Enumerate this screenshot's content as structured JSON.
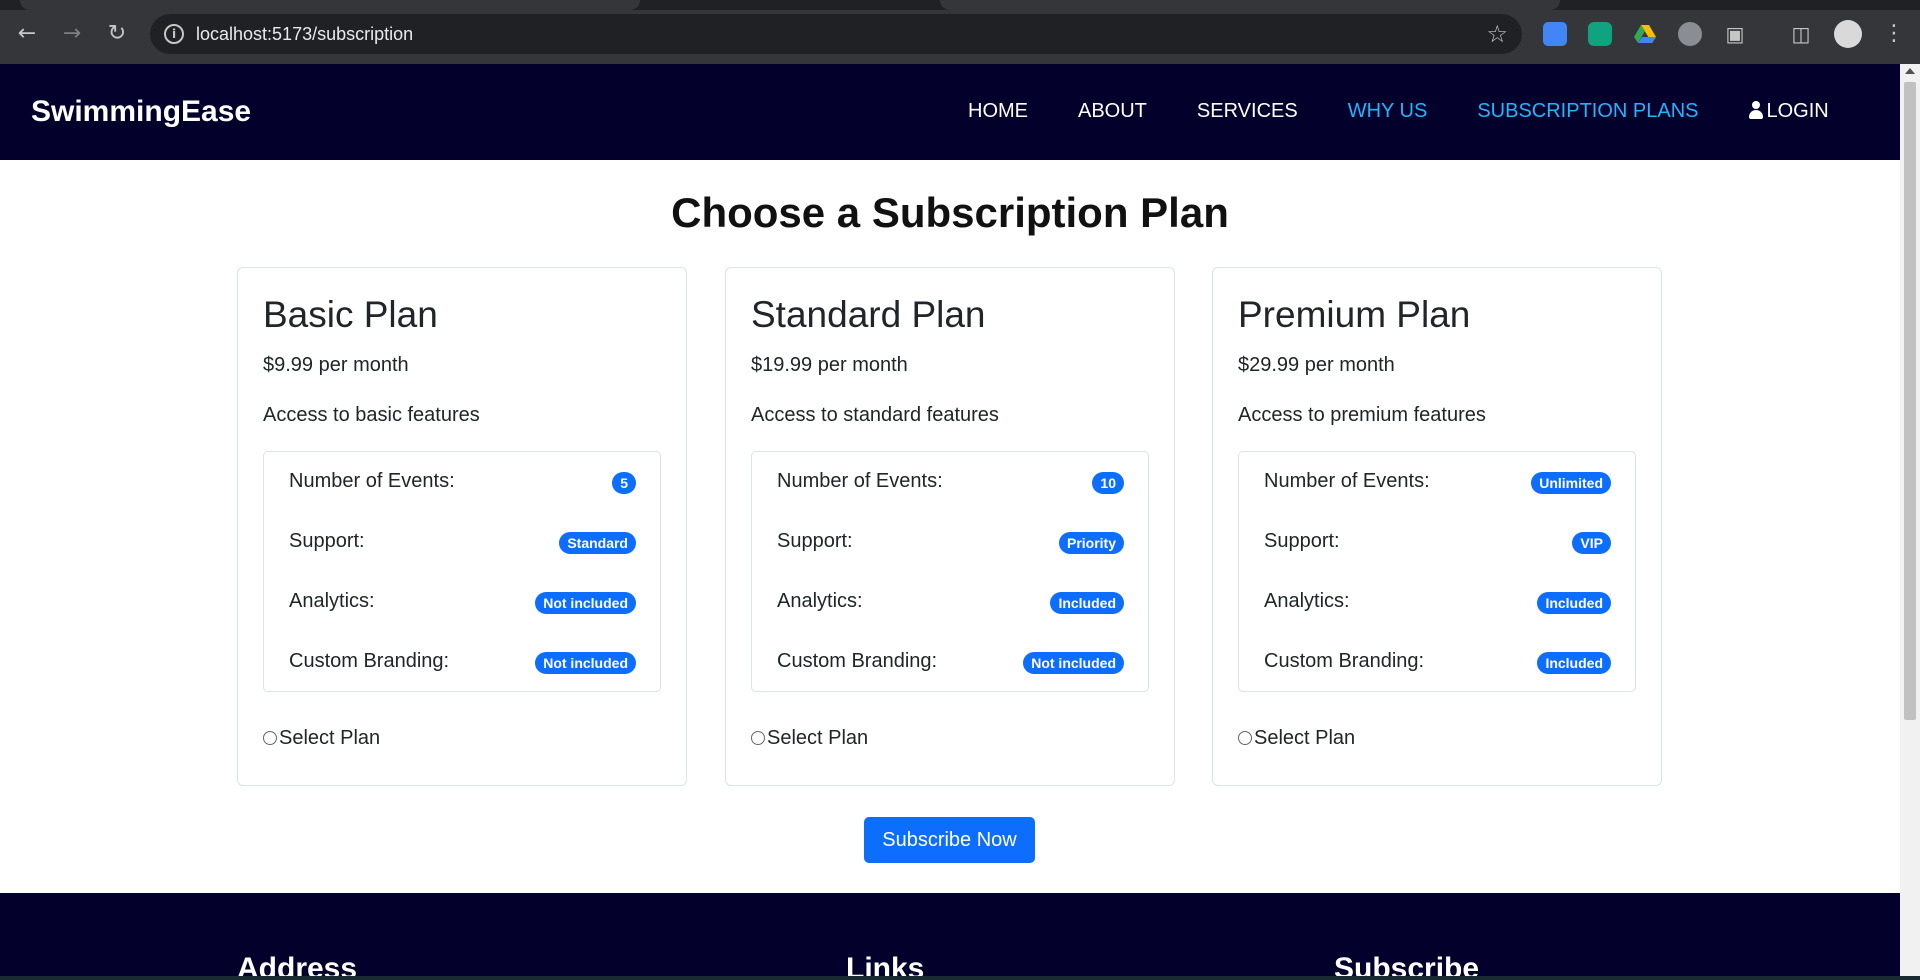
{
  "browser": {
    "url": "localhost:5173/subscription",
    "back_icon": "arrow-left-icon",
    "forward_icon": "arrow-right-icon",
    "reload_icon": "reload-icon",
    "info_icon": "info-icon",
    "star_icon": "star-icon",
    "menu_icon": "kebab-menu-icon"
  },
  "navbar": {
    "brand": "SwimmingEase",
    "links": [
      {
        "label": "HOME"
      },
      {
        "label": "ABOUT"
      },
      {
        "label": "SERVICES"
      },
      {
        "label": "WHY US"
      },
      {
        "label": "SUBSCRIPTION PLANS"
      },
      {
        "label": "LOGIN"
      }
    ]
  },
  "main": {
    "title": "Choose a Subscription Plan",
    "plans": [
      {
        "name": "Basic Plan",
        "price": "$9.99 per month",
        "description": "Access to basic features",
        "features": [
          {
            "label": "Number of Events:",
            "value": "5"
          },
          {
            "label": "Support:",
            "value": "Standard"
          },
          {
            "label": "Analytics:",
            "value": "Not included"
          },
          {
            "label": "Custom Branding:",
            "value": "Not included"
          }
        ],
        "select_label": "Select Plan"
      },
      {
        "name": "Standard Plan",
        "price": "$19.99 per month",
        "description": "Access to standard features",
        "features": [
          {
            "label": "Number of Events:",
            "value": "10"
          },
          {
            "label": "Support:",
            "value": "Priority"
          },
          {
            "label": "Analytics:",
            "value": "Included"
          },
          {
            "label": "Custom Branding:",
            "value": "Not included"
          }
        ],
        "select_label": "Select Plan"
      },
      {
        "name": "Premium Plan",
        "price": "$29.99 per month",
        "description": "Access to premium features",
        "features": [
          {
            "label": "Number of Events:",
            "value": "Unlimited"
          },
          {
            "label": "Support:",
            "value": "VIP"
          },
          {
            "label": "Analytics:",
            "value": "Included"
          },
          {
            "label": "Custom Branding:",
            "value": "Included"
          }
        ],
        "select_label": "Select Plan"
      }
    ],
    "subscribe_button": "Subscribe Now"
  },
  "footer": {
    "headings": [
      "Address",
      "Links",
      "Subscribe"
    ]
  },
  "colors": {
    "navbar_bg": "#03012b",
    "active_link": "#1fb6ff",
    "badge": "#0d6efd",
    "button": "#0d6efd"
  }
}
